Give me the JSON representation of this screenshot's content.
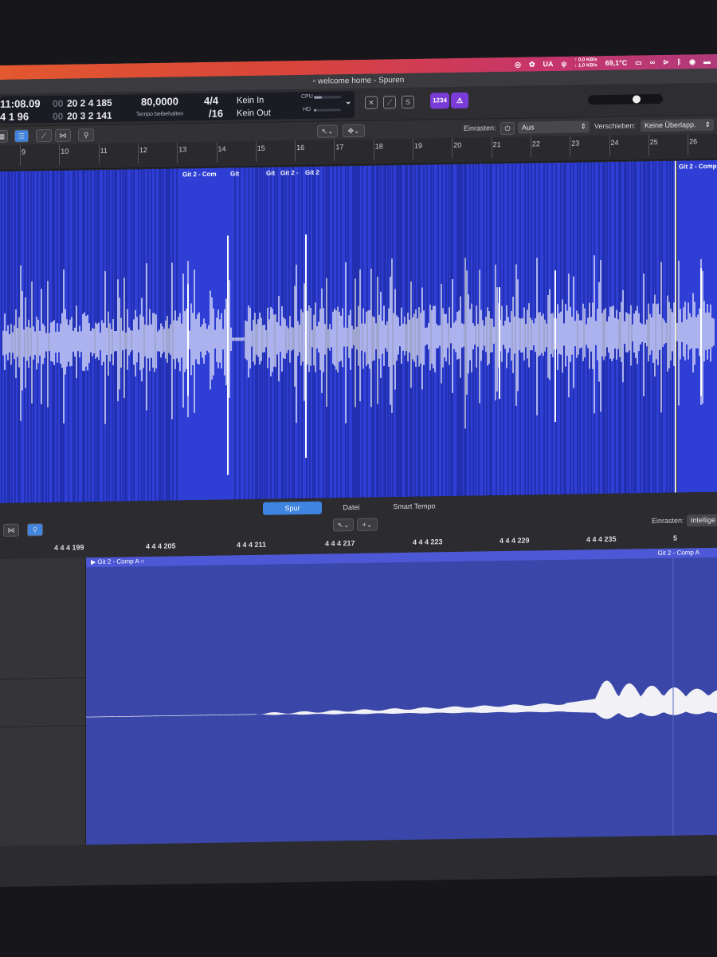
{
  "menubar": {
    "items": [
      "UA",
      "69,1°C",
      "∞"
    ],
    "net_up": "↑ 0,0 KB/s",
    "net_down": "↓ 1,0 KB/s"
  },
  "window": {
    "title": "welcome home - Spuren"
  },
  "lcd": {
    "time_top": "11:08.09",
    "time_bottom": "4  1   96",
    "pos_top_dim": "00",
    "pos_top": "20  2  4  185",
    "pos_bottom_dim": "00",
    "pos_bottom": "20  3  2  141",
    "tempo": "80,0000",
    "tempo_label": "Tempo beibehalten",
    "sig_top": "4/4",
    "sig_bottom": "/16",
    "in_label": "Kein In",
    "out_label": "Kein Out",
    "cpu_label": "CPU",
    "hd_label": "HD",
    "cpu_level": 0.3,
    "hd_level": 0.1
  },
  "control": {
    "count_in_label": "1234",
    "volume_level": 0.67
  },
  "toolbar": {
    "snap_label": "Einrasten:",
    "snap_value": "Aus",
    "drag_label": "Verschieben:",
    "drag_value": "Keine Überlapp."
  },
  "ruler": {
    "bars": [
      "9",
      "10",
      "11",
      "12",
      "13",
      "14",
      "15",
      "16",
      "17",
      "18",
      "19",
      "20",
      "21",
      "22",
      "23",
      "24",
      "25",
      "26"
    ]
  },
  "regions": {
    "labels": [
      "Git 2 - Com",
      "Git",
      "Git",
      "Git 2 -",
      "Git 2",
      "Git 2 - Comp A"
    ]
  },
  "editor": {
    "tabs": [
      "Spur",
      "Datei",
      "Smart Tempo"
    ],
    "active_tab": "Spur",
    "snap_label": "Einrasten:",
    "snap_value": "Intellige",
    "ruler": [
      "4 4 4 199",
      "4 4 4 205",
      "4 4 4 211",
      "4 4 4 217",
      "4 4 4 223",
      "4 4 4 229",
      "4 4 4 235",
      "5"
    ],
    "region_name": "Git 2 - Comp A",
    "region_name_right": "Git 2 - Comp A"
  },
  "colors": {
    "region": "#2f3fd6",
    "editor_region": "#3a47a8",
    "accent": "#3f84e0",
    "menubar": "#d9453a"
  }
}
